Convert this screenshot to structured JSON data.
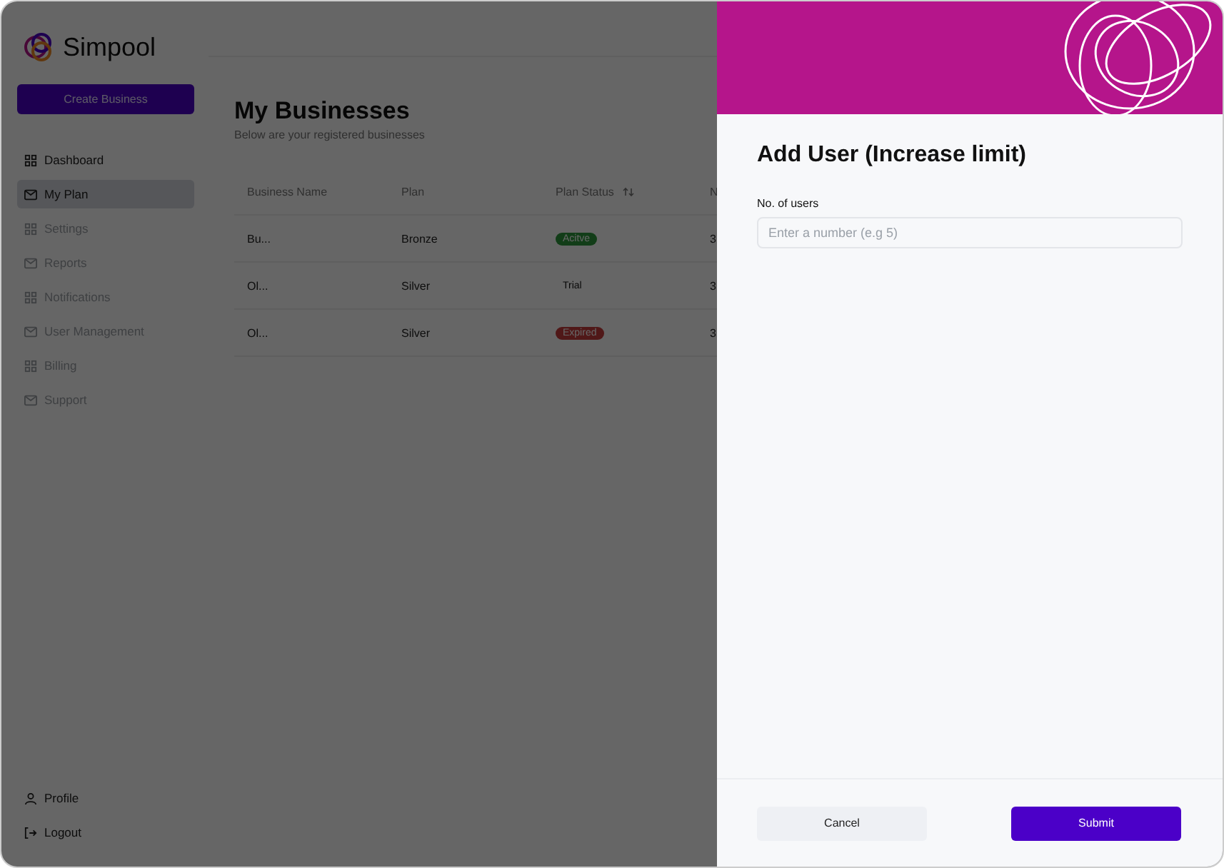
{
  "brand": {
    "name": "Simpool"
  },
  "create_button": "Create Business",
  "sidebar": {
    "items": [
      {
        "label": "Dashboard",
        "kind": "grid",
        "selected": false,
        "disabled": false
      },
      {
        "label": "My Plan",
        "kind": "mail",
        "selected": true,
        "disabled": false
      },
      {
        "label": "Settings",
        "kind": "grid",
        "selected": false,
        "disabled": true
      },
      {
        "label": "Reports",
        "kind": "mail",
        "selected": false,
        "disabled": true
      },
      {
        "label": "Notifications",
        "kind": "grid",
        "selected": false,
        "disabled": true
      },
      {
        "label": "User Management",
        "kind": "mail",
        "selected": false,
        "disabled": true
      },
      {
        "label": "Billing",
        "kind": "grid",
        "selected": false,
        "disabled": true
      },
      {
        "label": "Support",
        "kind": "mail",
        "selected": false,
        "disabled": true
      }
    ],
    "bottom": [
      {
        "label": "Profile",
        "kind": "user"
      },
      {
        "label": "Logout",
        "kind": "logout"
      }
    ]
  },
  "page": {
    "title": "My Businesses",
    "subtitle": "Below are your registered businesses"
  },
  "table": {
    "columns": [
      {
        "label": "Business Name"
      },
      {
        "label": "Plan"
      },
      {
        "label": "Plan Status",
        "sortable": true
      },
      {
        "label": "N"
      }
    ],
    "rows": [
      {
        "name": "Bu...",
        "plan": "Bronze",
        "status": {
          "label": "Acitve",
          "kind": "active"
        },
        "column_4": "3"
      },
      {
        "name": "Ol...",
        "plan": "Silver",
        "status": {
          "label": "Trial",
          "kind": "trial"
        },
        "column_4": "3"
      },
      {
        "name": "Ol...",
        "plan": "Silver",
        "status": {
          "label": "Expired",
          "kind": "expired"
        },
        "column_4": "3"
      }
    ]
  },
  "drawer": {
    "title": "Add User (Increase limit)",
    "field": {
      "label": "No. of users",
      "placeholder": "Enter a number (e.g 5)"
    },
    "buttons": [
      {
        "label": "Cancel",
        "kind": "secondary"
      },
      {
        "label": "Submit",
        "kind": "primary"
      }
    ]
  }
}
